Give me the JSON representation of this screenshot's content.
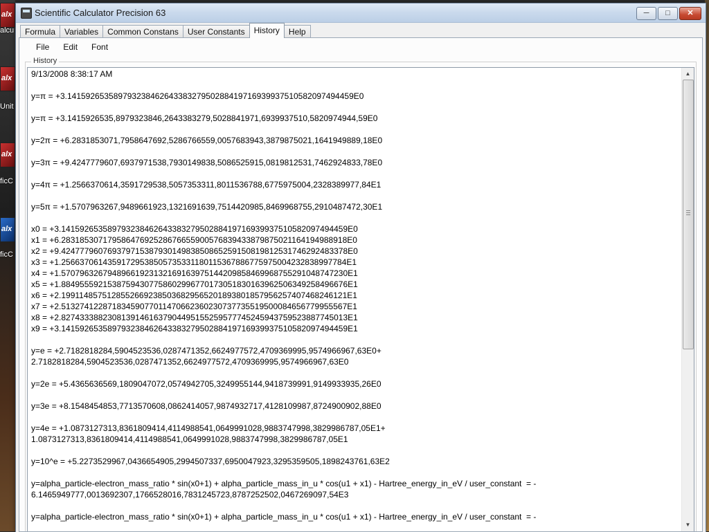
{
  "window": {
    "title": "Scientific Calculator Precision 63",
    "minimize_glyph": "─",
    "maximize_glyph": "□",
    "close_glyph": "✕"
  },
  "desktop": {
    "icons": [
      {
        "glyph": "alx",
        "label": "alcu"
      },
      {
        "glyph": "alx",
        "label": "Unit"
      },
      {
        "glyph": "alx",
        "label": "ficC"
      },
      {
        "glyph": "alx",
        "label": "ficC"
      }
    ]
  },
  "tabs": [
    "Formula",
    "Variables",
    "Common Constans",
    "User Constants",
    "History",
    "Help"
  ],
  "active_tab": "History",
  "menu": [
    "File",
    "Edit",
    "Font"
  ],
  "history": {
    "group_label": "History",
    "lines": [
      "9/13/2008 8:38:17 AM",
      "",
      "y=π = +3.14159265358979323846264338327950288419716939937510582097494459E0",
      "",
      "y=π = +3.1415926535,8979323846,2643383279,5028841971,6939937510,5820974944,59E0",
      "",
      "y=2π = +6.2831853071,7958647692,5286766559,0057683943,3879875021,1641949889,18E0",
      "",
      "y=3π = +9.4247779607,6937971538,7930149838,5086525915,0819812531,7462924833,78E0",
      "",
      "y=4π = +1.2566370614,3591729538,5057353311,8011536788,6775975004,2328389977,84E1",
      "",
      "y=5π = +1.5707963267,9489661923,1321691639,7514420985,8469968755,2910487472,30E1",
      "",
      "x0 = +3.14159265358979323846264338327950288419716939937510582097494459E0",
      "x1 = +6.28318530717958647692528676655900576839433879875021164194988918E0",
      "x2 = +9.42477796076937971538793014983850865259150819812531746292483378E0",
      "x3 = +1.25663706143591729538505735331180115367886775975004232838997784E1",
      "x4 = +1.57079632679489661923132169163975144209858469968755291048747230E1",
      "x5 = +1.88495559215387594307758602996770173051830163962506349258496676E1",
      "x6 = +2.19911485751285526692385036829565201893801857956257407468246121E1",
      "x7 = +2.51327412287183459077011470662360230737735519500084656779955567E1",
      "x8 = +2.82743338823081391461637904495155259577745245943759523887745013E1",
      "x9 = +3.14159265358979323846264338327950288419716939937510582097494459E1",
      "",
      "y=e = +2.7182818284,5904523536,0287471352,6624977572,4709369995,9574966967,63E0+",
      "2.7182818284,5904523536,0287471352,6624977572,4709369995,9574966967,63E0",
      "",
      "y=2e = +5.4365636569,1809047072,0574942705,3249955144,9418739991,9149933935,26E0",
      "",
      "y=3e = +8.1548454853,7713570608,0862414057,9874932717,4128109987,8724900902,88E0",
      "",
      "y=4e = +1.0873127313,8361809414,4114988541,0649991028,9883747998,3829986787,05E1+",
      "1.0873127313,8361809414,4114988541,0649991028,9883747998,3829986787,05E1",
      "",
      "y=10^e = +5.2273529967,0436654905,2994507337,6950047923,3295359505,1898243761,63E2",
      "",
      "y=alpha_particle-electron_mass_ratio * sin(x0+1) + alpha_particle_mass_in_u * cos(u1 + x1) - Hartree_energy_in_eV / user_constant  = -",
      "6.1465949777,0013692307,1766528016,7831245723,8787252502,0467269097,54E3",
      "",
      "y=alpha_particle-electron_mass_ratio * sin(x0+1) + alpha_particle_mass_in_u * cos(u1 + x1) - Hartree_energy_in_eV / user_constant  = -"
    ]
  },
  "scrollbar": {
    "up_glyph": "▲",
    "down_glyph": "▼"
  }
}
